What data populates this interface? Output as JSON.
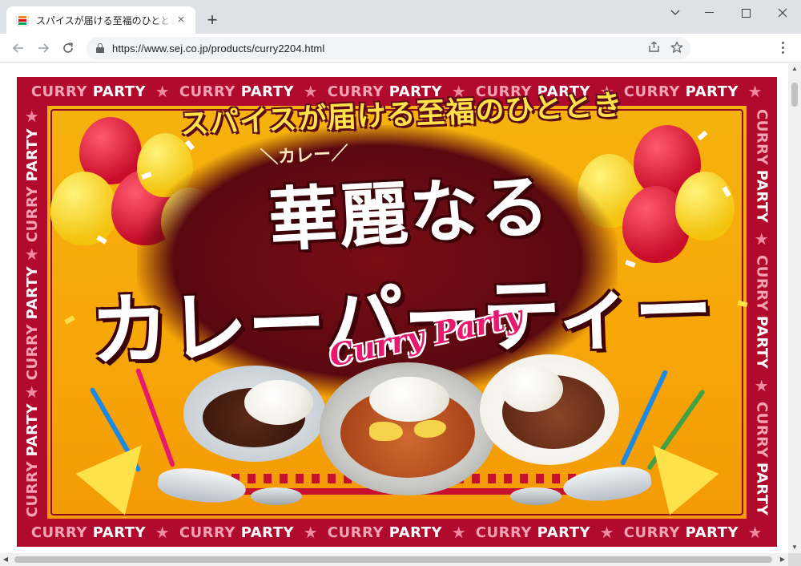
{
  "browser": {
    "tab_title": "スパイスが届ける至福のひととき 華麗",
    "tab_close_glyph": "×",
    "new_tab_glyph": "+",
    "url": "https://www.sej.co.jp/products/curry2204.html",
    "window_controls": {
      "minimize": "—",
      "maximize": "☐",
      "close": "✕",
      "tab_search": "⌄"
    },
    "nav": {
      "back": "←",
      "forward": "→",
      "reload": "↻"
    },
    "omnibox_icons": {
      "share": "⇪",
      "bookmark": "☆"
    }
  },
  "banner": {
    "frame_text_curry": "CURRY",
    "frame_text_party": "PARTY",
    "frame_star": "★",
    "headline": "スパイスが届ける至福のひととき",
    "sublabel": "＼カレー／",
    "title_line1": "華麗なる",
    "title_line2": "カレーパーティー",
    "script_label": "Curry Party",
    "colors": {
      "frame": "#b00a2c",
      "background": "#f5b20c",
      "title_shadow": "#3d0208",
      "headline": "#ffe14a",
      "script": "#e8196d"
    }
  },
  "scrollbars": {
    "up": "▲",
    "down": "▼",
    "left": "◀",
    "right": "▶"
  }
}
